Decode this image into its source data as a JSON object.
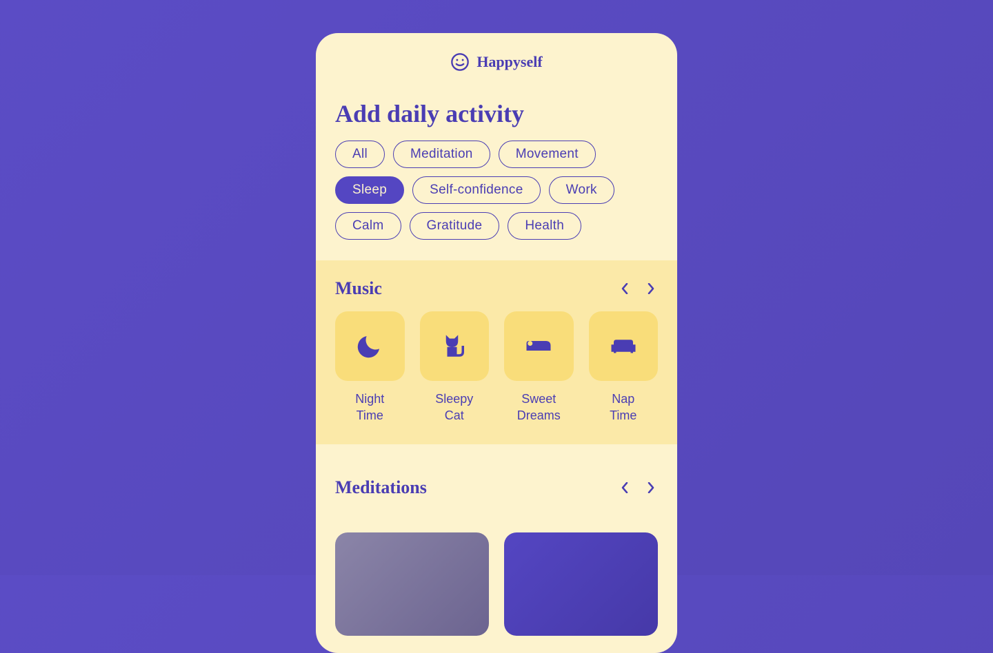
{
  "brand": "Happyself",
  "page_title": "Add daily activity",
  "categories": [
    {
      "label": "All",
      "active": false
    },
    {
      "label": "Meditation",
      "active": false
    },
    {
      "label": "Movement",
      "active": false
    },
    {
      "label": "Sleep",
      "active": true
    },
    {
      "label": "Self-confidence",
      "active": false
    },
    {
      "label": "Work",
      "active": false
    },
    {
      "label": "Calm",
      "active": false
    },
    {
      "label": "Gratitude",
      "active": false
    },
    {
      "label": "Health",
      "active": false
    }
  ],
  "sections": {
    "music": {
      "title": "Music",
      "items": [
        {
          "label": "Night\nTime",
          "icon": "moon-icon"
        },
        {
          "label": "Sleepy\nCat",
          "icon": "cat-icon"
        },
        {
          "label": "Sweet\nDreams",
          "icon": "bed-icon"
        },
        {
          "label": "Nap\nTime",
          "icon": "couch-icon"
        }
      ]
    },
    "meditations": {
      "title": "Meditations"
    }
  }
}
